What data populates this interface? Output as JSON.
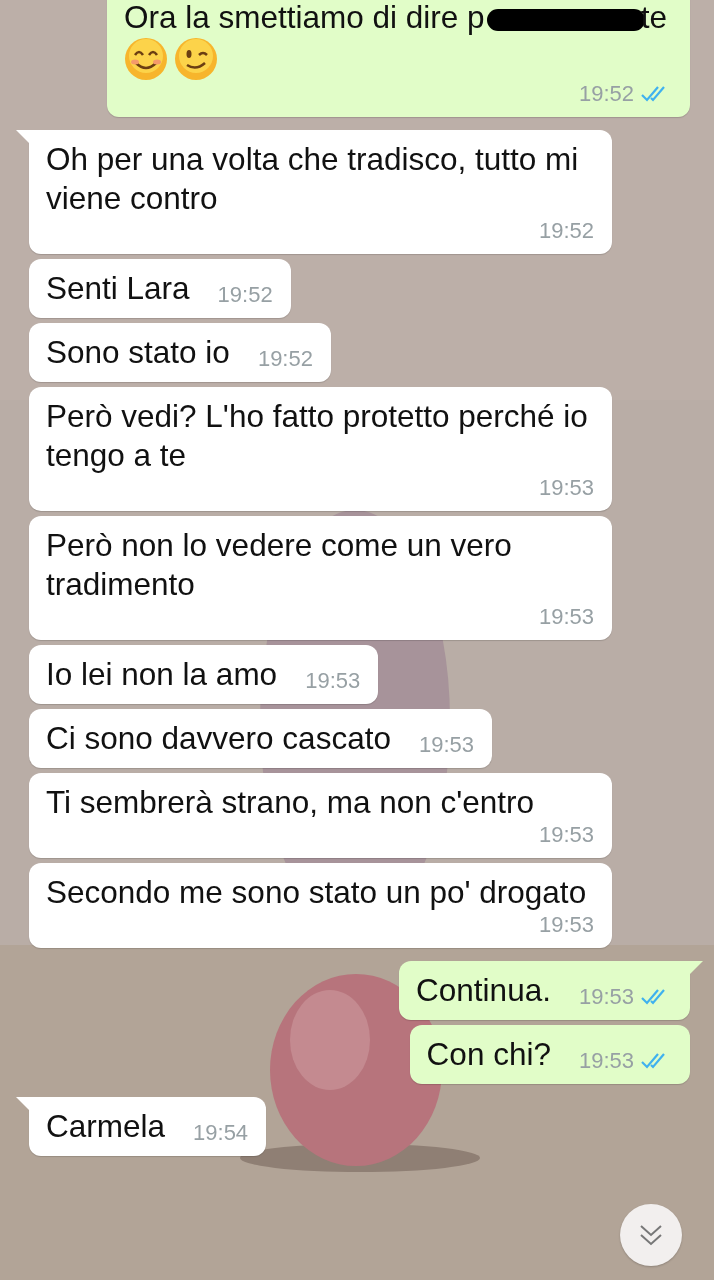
{
  "messages": [
    {
      "kind": "sent",
      "tail": false,
      "text": "Ora la smettiamo di dire p",
      "redacted": true,
      "text_after": "te",
      "icons": [
        {
          "kind": "smiling"
        },
        {
          "kind": "winking"
        }
      ],
      "time": "19:52",
      "read": true
    },
    {
      "kind": "received",
      "tail": true,
      "text": "Oh per una volta che tradisco, tutto mi viene contro",
      "time": "19:52"
    },
    {
      "kind": "received",
      "tail": false,
      "text": "Senti Lara",
      "time": "19:52"
    },
    {
      "kind": "received",
      "tail": false,
      "text": "Sono stato io",
      "time": "19:52"
    },
    {
      "kind": "received",
      "tail": false,
      "text": "Però vedi? L'ho fatto protetto perché io tengo a te",
      "time": "19:53"
    },
    {
      "kind": "received",
      "tail": false,
      "text": "Però non lo vedere come un vero tradimento",
      "time": "19:53"
    },
    {
      "kind": "received",
      "tail": false,
      "text": "Io lei non la amo",
      "time": "19:53"
    },
    {
      "kind": "received",
      "tail": false,
      "text": "Ci sono davvero cascato",
      "time": "19:53"
    },
    {
      "kind": "received",
      "tail": false,
      "text": "Ti sembrerà strano, ma non c'entro",
      "time": "19:53"
    },
    {
      "kind": "received",
      "tail": false,
      "text": "Secondo me sono stato un po' drogato",
      "time": "19:53"
    },
    {
      "kind": "sent",
      "tail": true,
      "text": "Continua.",
      "time": "19:53",
      "read": true
    },
    {
      "kind": "sent",
      "tail": false,
      "text": "Con chi?",
      "time": "19:53",
      "read": true
    },
    {
      "kind": "received",
      "tail": true,
      "text": "Carmela",
      "time": "19:54"
    }
  ]
}
